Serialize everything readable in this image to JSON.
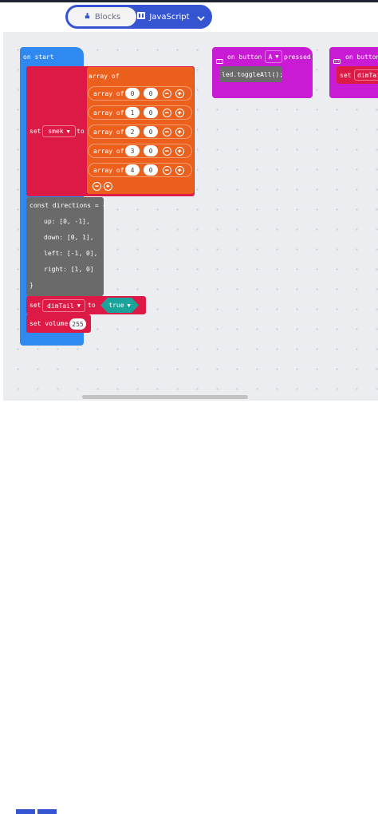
{
  "editor": {
    "blocks_tab": "Blocks",
    "javascript_tab": "JavaScript"
  },
  "on_start": {
    "label": "on start",
    "set_label": "set",
    "variable": "smek",
    "to_label": "to",
    "array_label": "array of",
    "item_label": "array of",
    "rows": [
      {
        "a": "0",
        "b": "0"
      },
      {
        "a": "1",
        "b": "0"
      },
      {
        "a": "2",
        "b": "0"
      },
      {
        "a": "3",
        "b": "0"
      },
      {
        "a": "4",
        "b": "0"
      }
    ],
    "code_lines": [
      "const directions = {",
      "up: [0, -1],",
      "down: [0, 1],",
      "left: [-1, 0],",
      "right: [1, 0]",
      "}"
    ],
    "set2_label": "set",
    "set2_variable": "dimTail",
    "to2_label": "to",
    "bool_value": "true",
    "volume_label": "set volume",
    "volume_value": "255"
  },
  "button_a": {
    "on_label": "on button",
    "button": "A",
    "event": "pressed",
    "code": "led.toggleAll();"
  },
  "button_b": {
    "on_label": "on button",
    "set_label": "set",
    "variable": "dimTai"
  },
  "colors": {
    "blue": "#2f89f0",
    "red": "#dd1a46",
    "orange": "#ec601d",
    "gray": "#6a6a6a",
    "magenta": "#c91bd4",
    "teal": "#1aa39b"
  },
  "icons": [
    "blocks-icon",
    "javascript-icon",
    "chevron-down-icon",
    "keyboard-icon",
    "remove-icon",
    "add-icon"
  ]
}
